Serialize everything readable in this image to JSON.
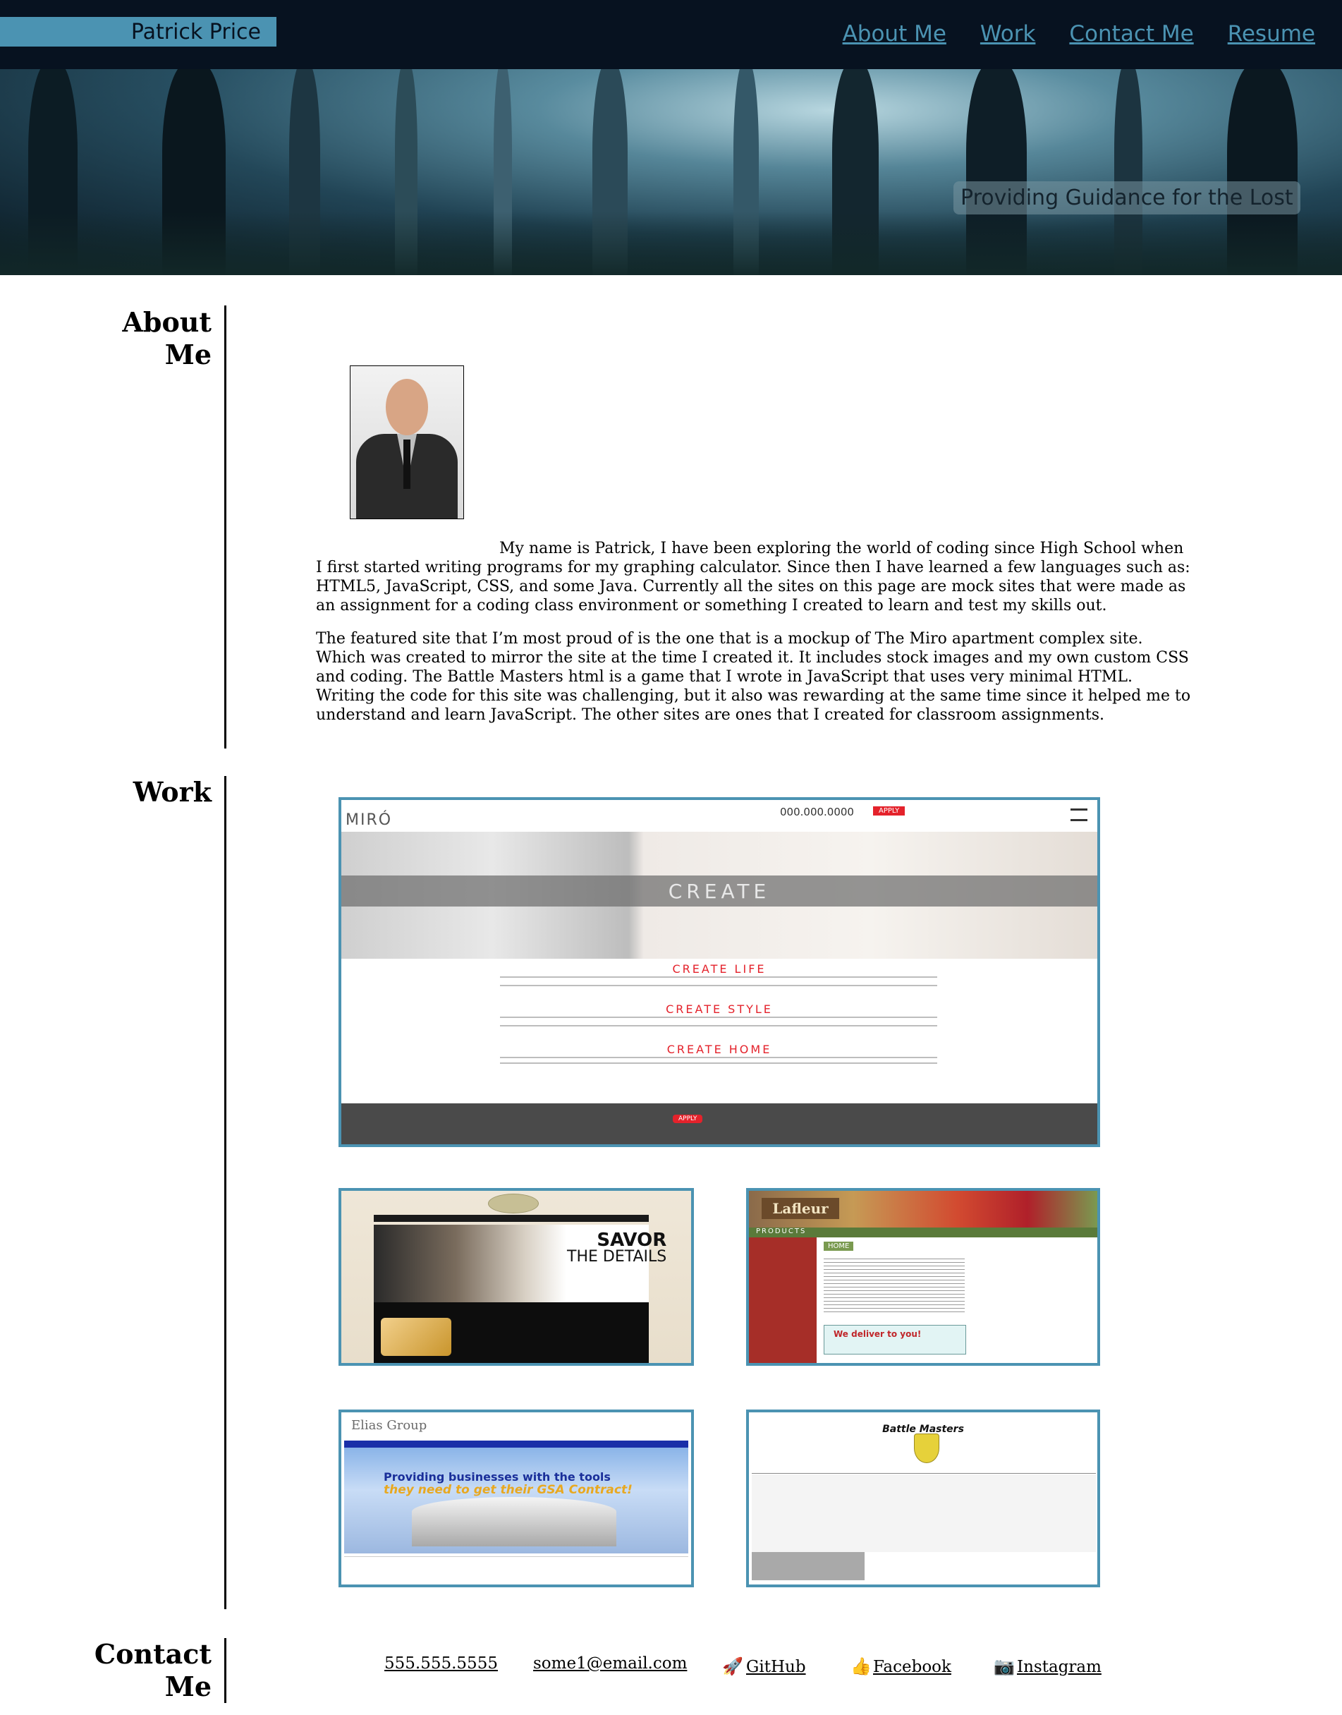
{
  "header": {
    "brand": "Patrick Price",
    "nav": [
      "About Me",
      "Work",
      "Contact Me",
      "Resume"
    ],
    "tagline": "Providing Guidance for the Lost"
  },
  "about": {
    "title_line1": "About",
    "title_line2": "Me",
    "paragraph1": "My name is Patrick, I have been exploring the world of coding since High School when I first started writing programs for my graphing calculator. Since then I have learned a few languages such as: HTML5, JavaScript, CSS, and some Java. Currently all the sites on this page are mock sites that were made as an assignment for a coding class environment or something I created to learn and test my skills out.",
    "paragraph2": "The featured site that I’m most proud of is the one that is a mockup of The Miro apartment complex site. Which was created to mirror the site at the time I created it. It includes stock images and my own custom CSS and coding. The Battle Masters html is a game that I wrote in JavaScript that uses very minimal HTML. Writing the code for this site was challenging, but it also was rewarding at the same time since it helped me to understand and learn JavaScript. The other sites are ones that I created for classroom assignments."
  },
  "work": {
    "title": "Work",
    "miro": {
      "logo": "MIRÓ",
      "phone": "000.000.0000",
      "apply": "APPLY",
      "hero": "CREATE",
      "headings": [
        "CREATE LIFE",
        "CREATE STYLE",
        "CREATE HOME"
      ]
    },
    "savor": {
      "title": "SAVOR",
      "subtitle": "THE DETAILS"
    },
    "lafleur": {
      "logo": "Lafleur",
      "products": "PRODUCTS",
      "home": "HOME",
      "deliver": "We deliver to you!"
    },
    "elias": {
      "logo": "Elias Group",
      "line1": "Providing businesses with the tools",
      "line2": "they need to get their GSA Contract!"
    },
    "battle": {
      "title": "Battle Masters"
    }
  },
  "contact": {
    "title_line1": "Contact",
    "title_line2": "Me",
    "phone": "555.555.5555",
    "email": "some1@email.com",
    "github": "GitHub",
    "facebook": "Facebook",
    "instagram": "Instagram",
    "icons": {
      "github": "rocket-icon",
      "facebook": "thumbs-up-icon",
      "instagram": "camera-icon"
    }
  },
  "colors": {
    "header_bg": "#071220",
    "accent": "#4b93b2",
    "miro_red": "#e4222b"
  }
}
